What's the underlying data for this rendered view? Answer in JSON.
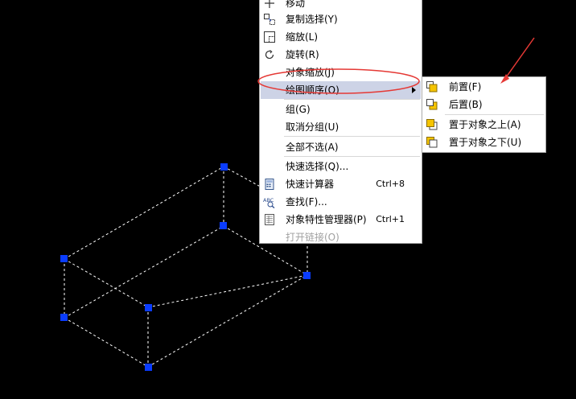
{
  "context_menu": {
    "items": [
      {
        "label": "移动",
        "icon": "move-icon"
      },
      {
        "label": "复制选择(Y)",
        "icon": "copy-select-icon"
      },
      {
        "label": "缩放(L)",
        "icon": "scale-icon"
      },
      {
        "label": "旋转(R)",
        "icon": "rotate-icon"
      },
      {
        "label": "对象缩放(J)",
        "icon": ""
      },
      {
        "label": "绘图顺序(O)",
        "icon": "",
        "has_submenu": true
      },
      {
        "label": "组(G)",
        "icon": ""
      },
      {
        "label": "取消分组(U)",
        "icon": ""
      },
      {
        "label": "全部不选(A)",
        "icon": ""
      },
      {
        "label": "快速选择(Q)...",
        "icon": ""
      },
      {
        "label": "快速计算器",
        "shortcut": "Ctrl+8",
        "icon": "calculator-icon"
      },
      {
        "label": "查找(F)...",
        "icon": "find-abc-icon"
      },
      {
        "label": "对象特性管理器(P)",
        "shortcut": "Ctrl+1",
        "icon": "properties-icon"
      },
      {
        "label": "打开链接(O)",
        "icon": "",
        "disabled": true
      }
    ]
  },
  "submenu": {
    "items": [
      {
        "label": "前置(F)",
        "icon": "bring-to-front-icon"
      },
      {
        "label": "后置(B)",
        "icon": "send-to-back-icon"
      },
      {
        "label": "置于对象之上(A)",
        "icon": "bring-above-object-icon"
      },
      {
        "label": "置于对象之下(U)",
        "icon": "send-under-object-icon"
      }
    ]
  },
  "colors": {
    "background": "#000000",
    "grip": "#0a3cff",
    "highlight": "#cdd3e6",
    "annotation": "#e53935"
  }
}
